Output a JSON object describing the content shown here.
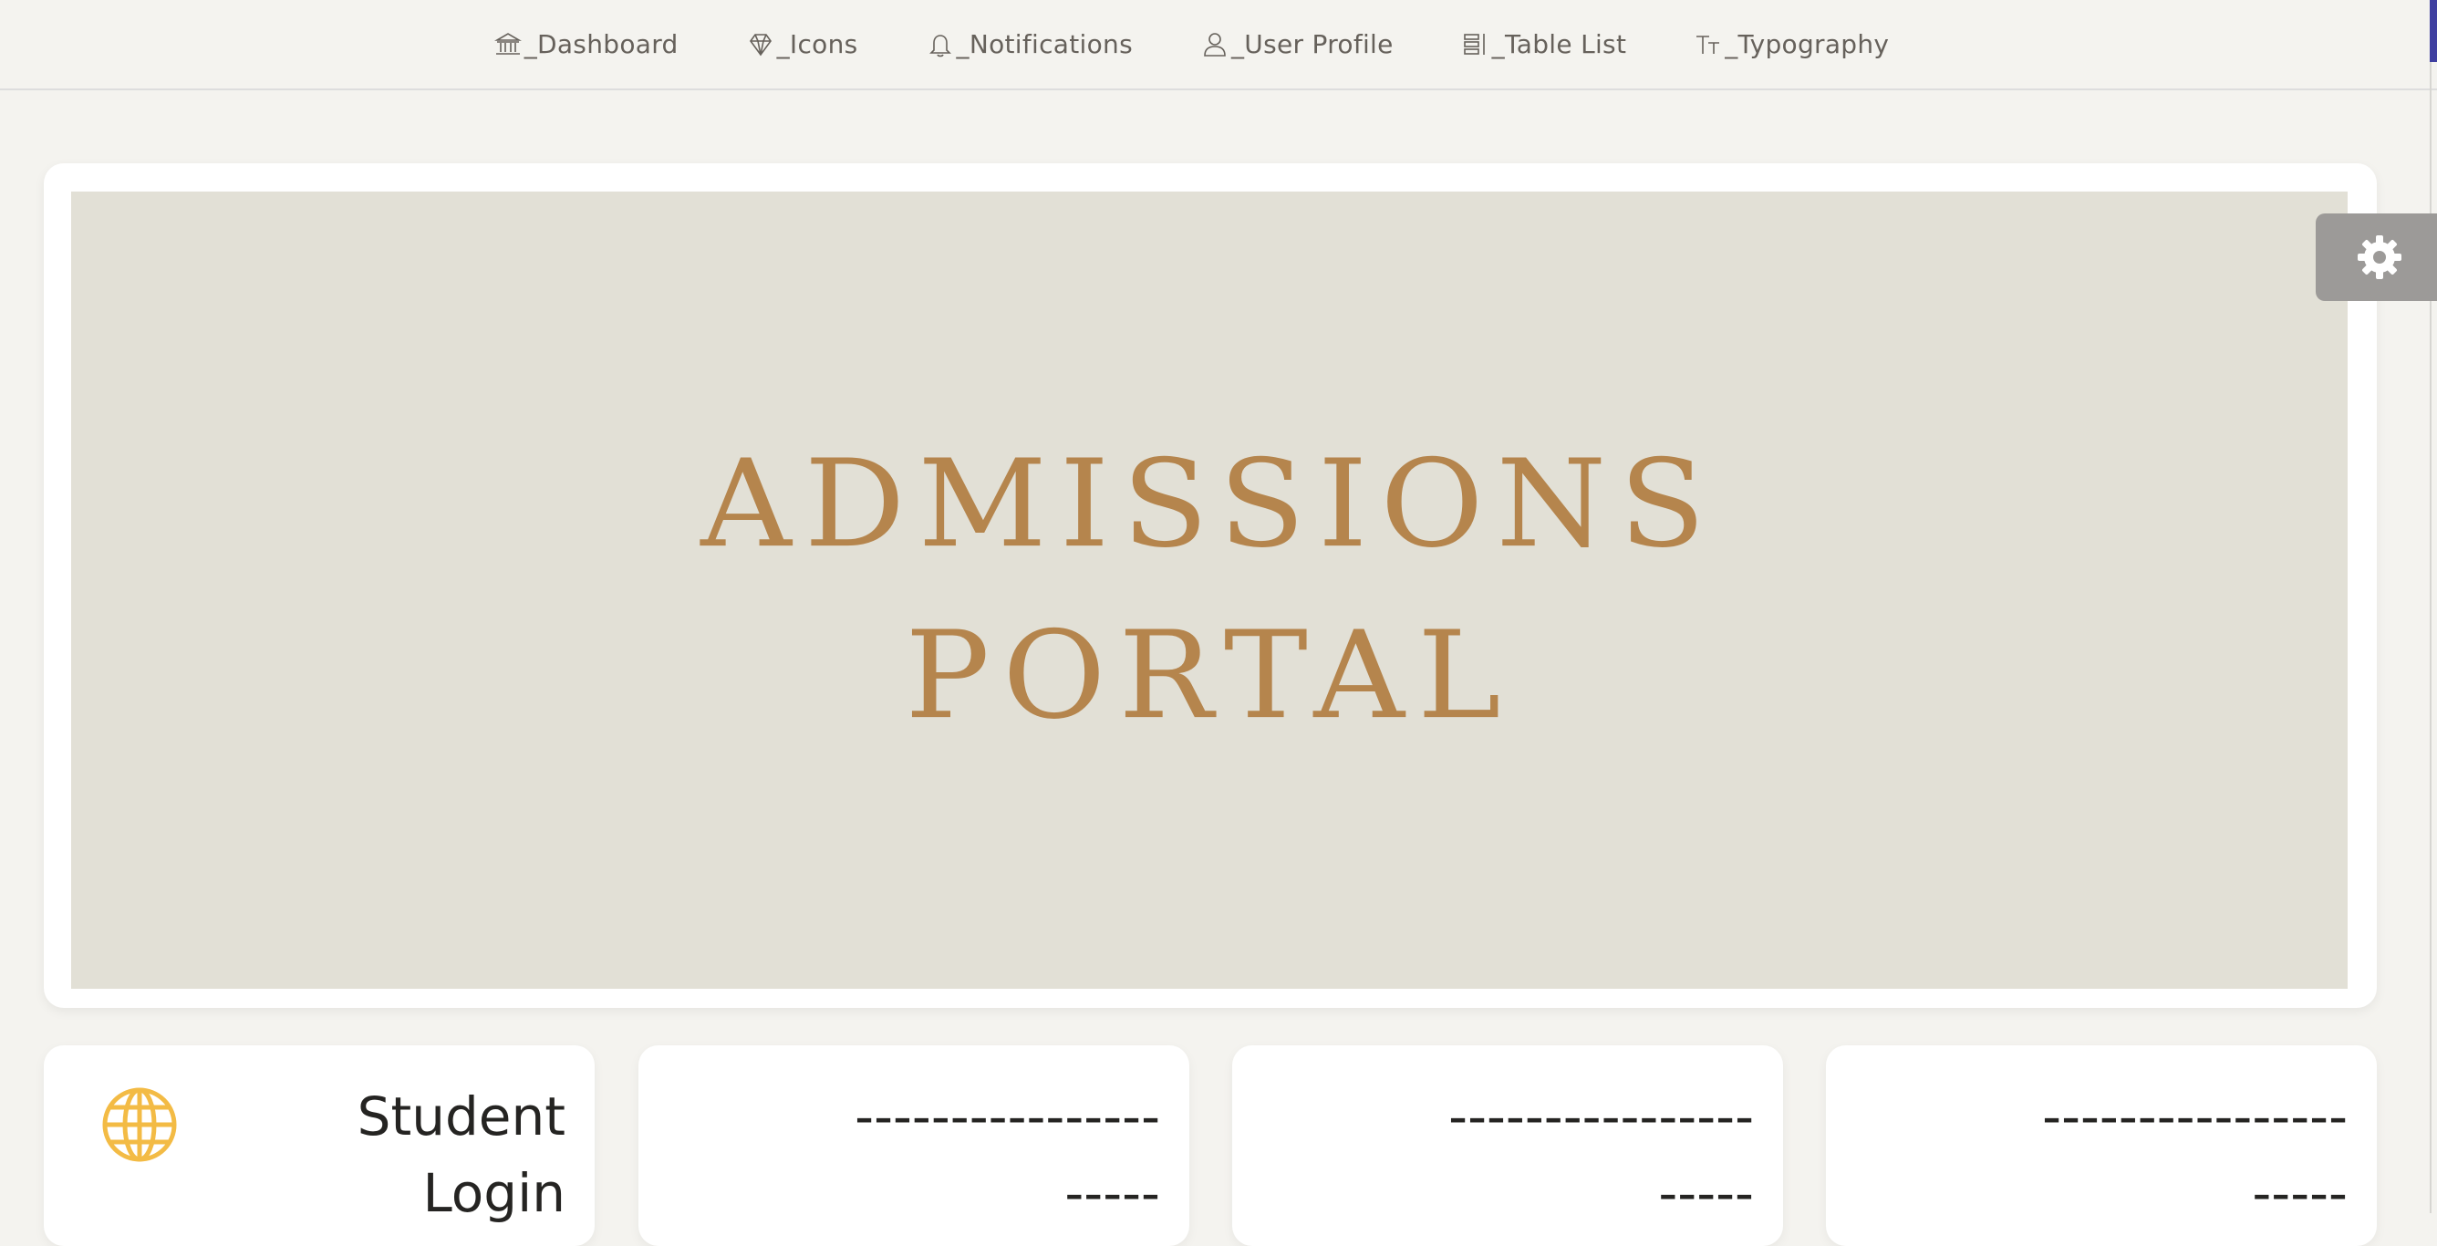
{
  "nav": {
    "items": [
      {
        "label": "_Dashboard",
        "icon": "bank-icon"
      },
      {
        "label": "_Icons",
        "icon": "diamond-icon"
      },
      {
        "label": "_Notifications",
        "icon": "bell-icon"
      },
      {
        "label": "_User Profile",
        "icon": "user-icon"
      },
      {
        "label": "_Table List",
        "icon": "table-list-icon"
      },
      {
        "label": "_Typography",
        "icon": "text-size-icon"
      }
    ]
  },
  "hero": {
    "line1": "ADMISSIONS",
    "line2": "PORTAL"
  },
  "settings": {
    "icon": "gear-icon"
  },
  "cards": [
    {
      "line1": "Student",
      "line2": "Login",
      "icon": "globe-icon"
    },
    {
      "line1": "----------------",
      "line2": "-----"
    },
    {
      "line1": "----------------",
      "line2": "-----"
    },
    {
      "line1": "----------------",
      "line2": "-----"
    }
  ],
  "colors": {
    "background": "#f4f3ef",
    "hero_panel": "#e2e0d6",
    "hero_text": "#b5854d",
    "accent_globe": "#f3bb45",
    "settings_tab": "#9c9a98"
  }
}
